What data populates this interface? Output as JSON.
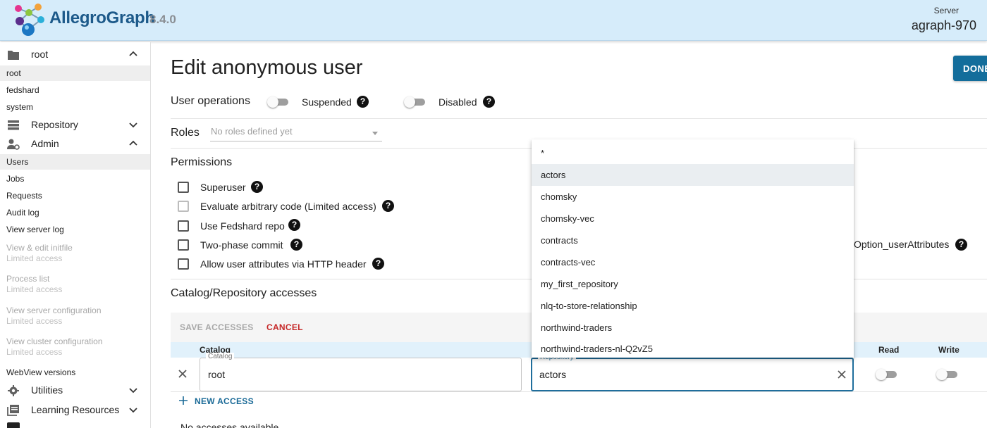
{
  "header": {
    "brand": "AllegroGraph",
    "version": "8.4.0",
    "server_label": "Server",
    "server_name": "agraph-970"
  },
  "sidebar": {
    "catalog_group": "root",
    "catalogs": [
      "root",
      "fedshard",
      "system"
    ],
    "repository_group": "Repository",
    "admin_group": "Admin",
    "admin_items": [
      "Users",
      "Jobs",
      "Requests",
      "Audit log",
      "View server log"
    ],
    "limited_items": [
      {
        "label": "View & edit initfile",
        "note": "Limited access"
      },
      {
        "label": "Process list",
        "note": "Limited access"
      },
      {
        "label": "View server configuration",
        "note": "Limited access"
      },
      {
        "label": "View cluster configuration",
        "note": "Limited access"
      }
    ],
    "webview_versions": "WebView versions",
    "utilities_group": "Utilities",
    "learning_group": "Learning Resources"
  },
  "main": {
    "title": "Edit anonymous user",
    "done_label": "DONE",
    "user_ops": {
      "title": "User operations",
      "suspended_label": "Suspended",
      "disabled_label": "Disabled",
      "help": "?"
    },
    "roles": {
      "title": "Roles",
      "placeholder": "No roles defined yet"
    },
    "permissions": {
      "title": "Permissions",
      "items": [
        "Superuser",
        "Evaluate arbitrary code (Limited access)",
        "Use Fedshard repo",
        "Two-phase commit",
        "Allow user attributes via HTTP header"
      ],
      "option_attr": "Option_userAttributes"
    },
    "accesses": {
      "title": "Catalog/Repository accesses",
      "save_label": "SAVE ACCESSES",
      "cancel_label": "CANCEL",
      "col_catalog": "Catalog",
      "col_read": "Read",
      "col_write": "Write",
      "catalog_field_label": "Catalog",
      "catalog_value": "root",
      "repo_field_label": "Repository",
      "repo_value": "actors",
      "new_access_label": "NEW ACCESS",
      "no_access": "No accesses available"
    },
    "repo_dropdown": [
      "*",
      "actors",
      "chomsky",
      "chomsky-vec",
      "contracts",
      "contracts-vec",
      "my_first_repository",
      "nlq-to-store-relationship",
      "northwind-traders",
      "northwind-traders-nl-Q2vZ5"
    ]
  }
}
